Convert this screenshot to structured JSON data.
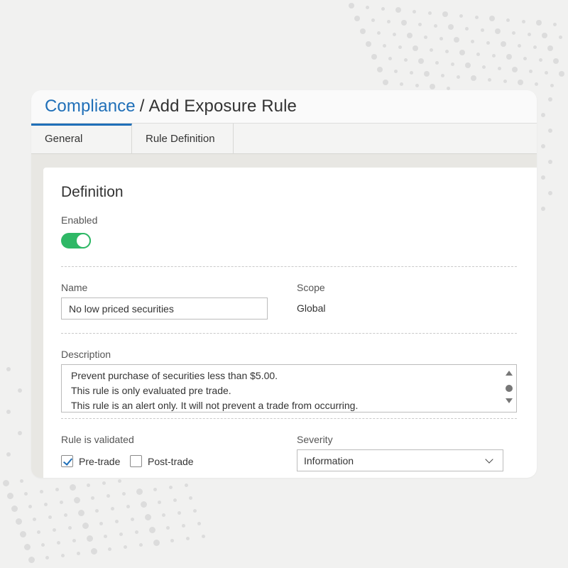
{
  "breadcrumb": {
    "parent": "Compliance",
    "separator": "/",
    "current": "Add Exposure Rule"
  },
  "tabs": [
    {
      "label": "General",
      "active": true
    },
    {
      "label": "Rule Definition",
      "active": false
    }
  ],
  "definition": {
    "title": "Definition",
    "enabled_label": "Enabled",
    "enabled": true,
    "name_label": "Name",
    "name_value": "No low priced securities",
    "scope_label": "Scope",
    "scope_value": "Global",
    "description_label": "Description",
    "description_lines": [
      "Prevent purchase of securities less than $5.00.",
      "This rule is only evaluated pre trade.",
      "This rule is an alert only. It will not prevent a trade from occurring."
    ],
    "validated_label": "Rule is validated",
    "pre_trade_label": "Pre-trade",
    "pre_trade_checked": true,
    "post_trade_label": "Post-trade",
    "post_trade_checked": false,
    "severity_label": "Severity",
    "severity_value": "Information"
  },
  "colors": {
    "link": "#1f6fb8",
    "toggle_on": "#2fb866",
    "background": "#f1f1f0"
  }
}
